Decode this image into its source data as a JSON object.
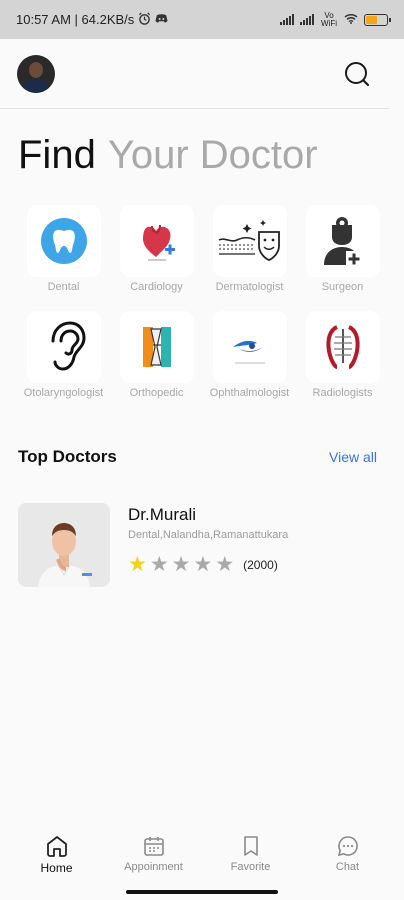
{
  "status": {
    "time_speed": "10:57 AM | 64.2KB/s",
    "vowifi": "Vo WiFi"
  },
  "headline": {
    "part1": "Find",
    "part2": "Your Doctor"
  },
  "categories": [
    {
      "label": "Dental",
      "icon": "tooth-icon"
    },
    {
      "label": "Cardiology",
      "icon": "heart-icon"
    },
    {
      "label": "Dermatologist",
      "icon": "skin-icon"
    },
    {
      "label": "Surgeon",
      "icon": "surgeon-icon"
    },
    {
      "label": "Otolaryngologist",
      "icon": "ear-icon"
    },
    {
      "label": "Orthopedic",
      "icon": "bone-icon"
    },
    {
      "label": "Ophthalmologist",
      "icon": "eye-icon"
    },
    {
      "label": "Radiologists",
      "icon": "xray-icon"
    }
  ],
  "top_doctors": {
    "title": "Top Doctors",
    "view_all": "View all"
  },
  "doctor": {
    "name": "Dr.Murali",
    "details": "Dental,Nalandha,Ramanattukara",
    "rating": 1,
    "rating_max": 5,
    "reviews": "(2000)"
  },
  "nav": {
    "home": "Home",
    "appointment": "Appoinment",
    "favorite": "Favorite",
    "chat": "Chat"
  },
  "colors": {
    "accent": "#3b73d9",
    "star": "#f4d21a",
    "muted": "#a9a9a9"
  }
}
